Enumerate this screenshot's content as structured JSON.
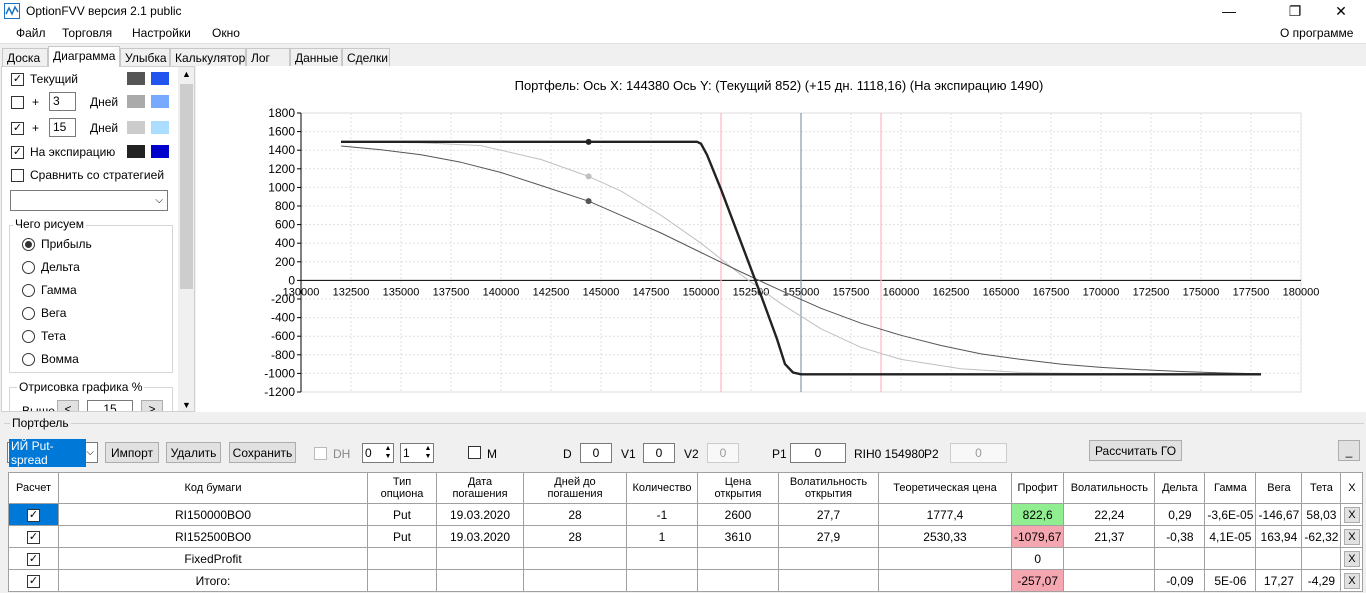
{
  "window": {
    "title": "OptionFVV версия 2.1 public",
    "minimize": "—",
    "maximize": "❐",
    "close": "✕"
  },
  "menu": {
    "file": "Файл",
    "trade": "Торговля",
    "settings": "Настройки",
    "window": "Окно",
    "about": "О программе"
  },
  "tabs": {
    "desk": "Доска",
    "diagram": "Диаграмма",
    "smile": "Улыбка",
    "calculator": "Калькулятор",
    "log": "Лог",
    "data": "Данные",
    "deals": "Сделки"
  },
  "left": {
    "current_label": "Текущий",
    "current_checked": true,
    "plus1_checked": false,
    "plus1_days": "3",
    "plus2_checked": true,
    "plus2_days": "15",
    "plus_sign": "+",
    "days_label": "Дней",
    "expiration_label": "На экспирацию",
    "expiration_checked": true,
    "compare_label": "Сравнить со стратегией",
    "compare_checked": false,
    "draw_group": "Чего рисуем",
    "draw_options": [
      "Прибыль",
      "Дельта",
      "Гамма",
      "Вега",
      "Тета",
      "Вомма"
    ],
    "draw_selected": 0,
    "render_group": "Отрисовка графика %",
    "above_label": "Выше",
    "above_value": "15",
    "dec": "<",
    "inc": ">",
    "colors": {
      "current": [
        "#555555",
        "#2255ee"
      ],
      "plus1": [
        "#aaaaaa",
        "#77aaff"
      ],
      "plus2": [
        "#cccccc",
        "#aaddff"
      ],
      "expiration": [
        "#222222",
        "#0000cc"
      ]
    }
  },
  "chart_title": "Портфель:  Ось X:  144380  Ось Y:   (Текущий 852)   (+15 дн. 1118,16)   (На экспирацию 1490)",
  "chart_data": {
    "type": "line",
    "xlim": [
      130000,
      180000
    ],
    "ylim": [
      -1200,
      1800
    ],
    "x_ticks": [
      130000,
      132500,
      135000,
      137500,
      140000,
      142500,
      145000,
      147500,
      150000,
      152500,
      155000,
      157500,
      160000,
      162500,
      165000,
      167500,
      170000,
      172500,
      175000,
      177500,
      180000
    ],
    "y_ticks": [
      1800,
      1600,
      1400,
      1200,
      1000,
      800,
      600,
      400,
      200,
      0,
      -200,
      -400,
      -600,
      -800,
      -1000,
      -1200
    ],
    "vlines": [
      {
        "x": 151000,
        "color": "#ffb6c1"
      },
      {
        "x": 155000,
        "color": "#8899aa"
      },
      {
        "x": 159000,
        "color": "#ffb6c1"
      }
    ],
    "cursor_x": 144380,
    "series": [
      {
        "color": "#222222",
        "width": 2.4,
        "points": [
          [
            132000,
            1490
          ],
          [
            149800,
            1490
          ],
          [
            150000,
            1470
          ],
          [
            150300,
            1350
          ],
          [
            151000,
            980
          ],
          [
            152000,
            410
          ],
          [
            153000,
            -160
          ],
          [
            153800,
            -630
          ],
          [
            154200,
            -900
          ],
          [
            154600,
            -990
          ],
          [
            155000,
            -1010
          ],
          [
            178000,
            -1010
          ]
        ]
      },
      {
        "color": "#555555",
        "width": 1,
        "points": [
          [
            132000,
            1445
          ],
          [
            134000,
            1405
          ],
          [
            136000,
            1350
          ],
          [
            138000,
            1270
          ],
          [
            140000,
            1160
          ],
          [
            142000,
            1020
          ],
          [
            144380,
            852
          ],
          [
            146000,
            700
          ],
          [
            148000,
            510
          ],
          [
            150000,
            300
          ],
          [
            152000,
            90
          ],
          [
            154000,
            -110
          ],
          [
            156000,
            -300
          ],
          [
            158000,
            -460
          ],
          [
            160000,
            -590
          ],
          [
            162000,
            -700
          ],
          [
            164000,
            -790
          ],
          [
            166000,
            -850
          ],
          [
            168000,
            -900
          ],
          [
            170000,
            -935
          ],
          [
            172000,
            -960
          ],
          [
            174000,
            -980
          ],
          [
            176000,
            -995
          ],
          [
            178000,
            -1005
          ]
        ]
      },
      {
        "color": "#c0c0c0",
        "width": 1,
        "points": [
          [
            132000,
            1490
          ],
          [
            136000,
            1480
          ],
          [
            139000,
            1450
          ],
          [
            142000,
            1300
          ],
          [
            144380,
            1118
          ],
          [
            146000,
            960
          ],
          [
            148000,
            700
          ],
          [
            150000,
            400
          ],
          [
            152000,
            60
          ],
          [
            154000,
            -250
          ],
          [
            156000,
            -520
          ],
          [
            158000,
            -720
          ],
          [
            160000,
            -850
          ],
          [
            163000,
            -950
          ],
          [
            166000,
            -990
          ],
          [
            170000,
            -1005
          ],
          [
            178000,
            -1010
          ]
        ]
      }
    ],
    "markers": [
      [
        144380,
        1490,
        "#222222"
      ],
      [
        144380,
        852,
        "#555555"
      ],
      [
        144380,
        1118,
        "#c0c0c0"
      ]
    ]
  },
  "portfolio": {
    "group_label": "Портфель",
    "selected_portfolio": "ИЙ Put-spread",
    "import": "Импорт",
    "delete": "Удалить",
    "save": "Сохранить",
    "dh_label": "DH",
    "spin1": "0",
    "spin2": "1",
    "m_label": "M",
    "d_label": "D",
    "d_value": "0",
    "v1_label": "V1",
    "v1_value": "0",
    "v2_label": "V2",
    "v2_value": "0",
    "p1_label": "P1",
    "p1_value": "0",
    "rih_label": "RIH0 154980",
    "p2_label": "P2",
    "p2_value": "0",
    "calc_go": "Рассчитать ГО",
    "minus": "_"
  },
  "table": {
    "headers": [
      "Расчет",
      "Код бумаги",
      "Тип опциона",
      "Дата погашения",
      "Дней до погашения",
      "Количество",
      "Цена открытия",
      "Волатильность открытия",
      "Теоретическая цена",
      "Профит",
      "Волатильность",
      "Дельта",
      "Гамма",
      "Вега",
      "Тета",
      "X"
    ],
    "rows": [
      [
        "RI150000BO0",
        "Put",
        "19.03.2020",
        "28",
        "-1",
        "2600",
        "27,7",
        "1777,4",
        "822,6",
        "22,24",
        "0,29",
        "-3,6E-05",
        "-146,67",
        "58,03",
        "X"
      ],
      [
        "RI152500BO0",
        "Put",
        "19.03.2020",
        "28",
        "1",
        "3610",
        "27,9",
        "2530,33",
        "-1079,67",
        "21,37",
        "-0,38",
        "4,1E-05",
        "163,94",
        "-62,32",
        "X"
      ],
      [
        "FixedProfit",
        "",
        "",
        "",
        "",
        "",
        "",
        "",
        "0",
        "",
        "",
        "",
        "",
        "",
        "X"
      ],
      [
        "Итого:",
        "",
        "",
        "",
        "",
        "",
        "",
        "",
        "-257,07",
        "",
        "-0,09",
        "5E-06",
        "17,27",
        "-4,29",
        "X"
      ]
    ],
    "profit_colors": [
      "#90ee90",
      "#f4a7b0",
      "",
      "#f4a7b0"
    ]
  }
}
